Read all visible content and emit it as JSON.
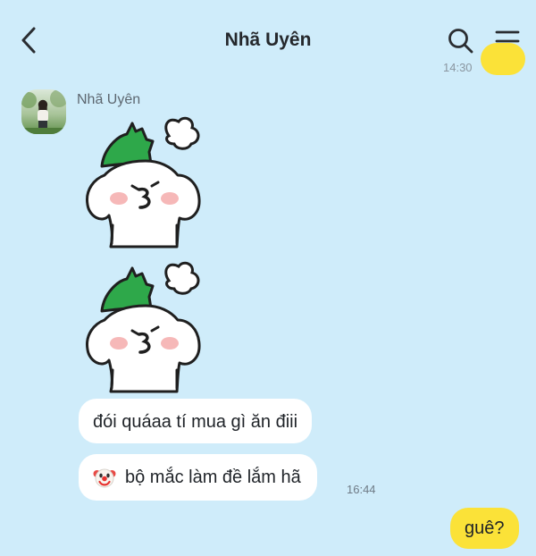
{
  "header": {
    "title": "Nhã Uyên",
    "back_icon": "chevron-left-icon",
    "search_icon": "search-icon",
    "menu_icon": "menu-icon"
  },
  "messages": {
    "top_time": "14:30",
    "sender_name": "Nhã Uyên",
    "sticker_1": "kiss-sticker",
    "sticker_2": "kiss-sticker",
    "text_1": "đói quáaa tí mua gì ăn điii",
    "text_2": "bộ mắc làm đề lắm hã",
    "text_2_emoji": "clown-face-icon",
    "time_2": "16:44",
    "my_text": "guê?"
  },
  "colors": {
    "background": "#cfecfa",
    "incoming_bubble": "#ffffff",
    "outgoing_bubble": "#fbe238"
  }
}
